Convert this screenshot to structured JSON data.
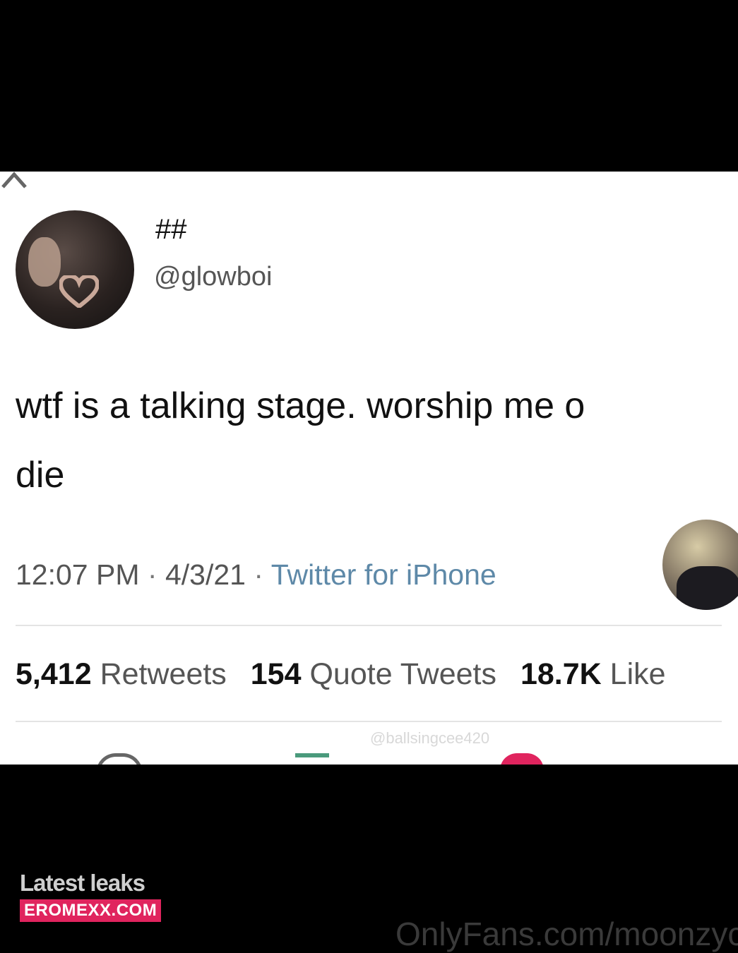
{
  "tweet": {
    "display_name": "##",
    "handle": "@glowboi",
    "text": "wtf is a talking stage. worship me o\ndie",
    "time": "12:07 PM",
    "date": "4/3/21",
    "source": "Twitter for iPhone",
    "separator": "·",
    "stats": {
      "retweets_count": "5,412",
      "retweets_label": "Retweets",
      "quote_count": "154",
      "quote_label": "Quote Tweets",
      "likes_count": "18.7K",
      "likes_label": "Like"
    },
    "watermark": "@ballsingcee420"
  },
  "footer": {
    "brand_top": "Latest leaks",
    "brand_bottom": "EROMEXX.COM",
    "onlyfans_text": "OnlyFans.com/moonzyca"
  },
  "colors": {
    "like": "#e0245e",
    "retweet": "#4a9a7c",
    "source_link": "#5e89a8"
  }
}
